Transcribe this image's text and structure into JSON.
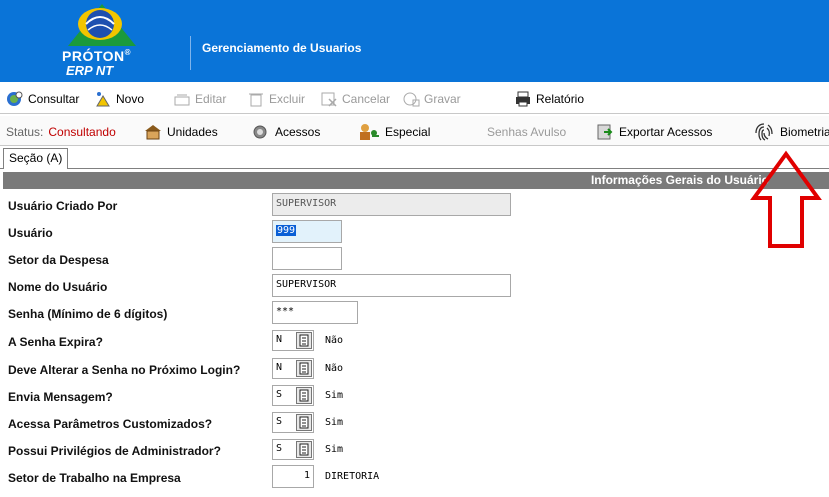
{
  "header": {
    "logo_line1": "PRÓTON",
    "logo_reg": "®",
    "logo_line2": "ERP NT",
    "title": "Gerenciamento de Usuarios"
  },
  "toolbar": {
    "consultar": "Consultar",
    "novo": "Novo",
    "editar": "Editar",
    "excluir": "Excluir",
    "cancelar": "Cancelar",
    "gravar": "Gravar",
    "relatorio": "Relatório"
  },
  "statusbar": {
    "status_label": "Status:",
    "status_value": "Consultando",
    "unidades": "Unidades",
    "acessos": "Acessos",
    "especial": "Especial",
    "senhas_avulso": "Senhas Avulso",
    "exportar_acessos": "Exportar Acessos",
    "biometria": "Biometria"
  },
  "tab": {
    "label": "Seção (A)"
  },
  "section": {
    "title": "Informações Gerais do Usuário"
  },
  "form": {
    "criado_por": {
      "label": "Usuário Criado Por",
      "value": "SUPERVISOR"
    },
    "usuario": {
      "label": "Usuário",
      "value": "999"
    },
    "setor_despesa": {
      "label": "Setor da Despesa",
      "value": ""
    },
    "nome": {
      "label": "Nome do Usuário",
      "value": "SUPERVISOR"
    },
    "senha": {
      "label": "Senha (Mínimo de 6 dígitos)",
      "value": "***"
    },
    "senha_expira": {
      "label": "A Senha Expira?",
      "value": "N",
      "desc": "Não"
    },
    "alterar_senha": {
      "label": "Deve Alterar a Senha no Próximo Login?",
      "value": "N",
      "desc": "Não"
    },
    "envia_mensagem": {
      "label": "Envia Mensagem?",
      "value": "S",
      "desc": "Sim"
    },
    "param_custom": {
      "label": "Acessa Parâmetros Customizados?",
      "value": "S",
      "desc": "Sim"
    },
    "admin": {
      "label": "Possui Privilégios de  Administrador?",
      "value": "S",
      "desc": "Sim"
    },
    "setor_trabalho": {
      "label": "Setor de Trabalho na Empresa",
      "value": "1",
      "desc": "DIRETORIA"
    }
  },
  "colors": {
    "header_bg": "#0a74d8",
    "status_value": "#c00000",
    "section_bg": "#7a7a7a",
    "arrow": "#e00000"
  }
}
